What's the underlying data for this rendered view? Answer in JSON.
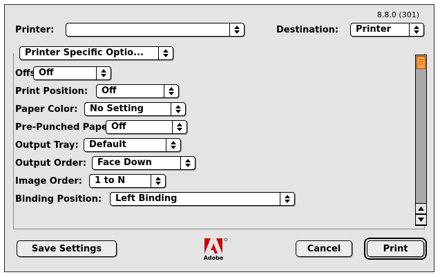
{
  "version": "8.8.0 (301)",
  "printer": {
    "label": "Printer:",
    "value": ""
  },
  "destination": {
    "label": "Destination:",
    "value": "Printer"
  },
  "panel": {
    "value": "Printer Specific Optio..."
  },
  "options": [
    {
      "label": "Offset:",
      "value": "Off"
    },
    {
      "label": "Print Position:",
      "value": "Off"
    },
    {
      "label": "Paper Color:",
      "value": "No Setting"
    },
    {
      "label": "Pre-Punched Paper:",
      "value": "Off"
    },
    {
      "label": "Output Tray:",
      "value": "Default"
    },
    {
      "label": "Output Order:",
      "value": "Face Down"
    },
    {
      "label": "Image Order:",
      "value": "1 to N"
    },
    {
      "label": "Binding Position:",
      "value": "Left Binding"
    }
  ],
  "buttons": {
    "save": "Save Settings",
    "cancel": "Cancel",
    "print": "Print"
  },
  "logo": {
    "text": "Adobe",
    "color": "#cc0000"
  },
  "colors": {
    "scroll_thumb": "#ff9a3d",
    "background": "#e4e4e4"
  }
}
